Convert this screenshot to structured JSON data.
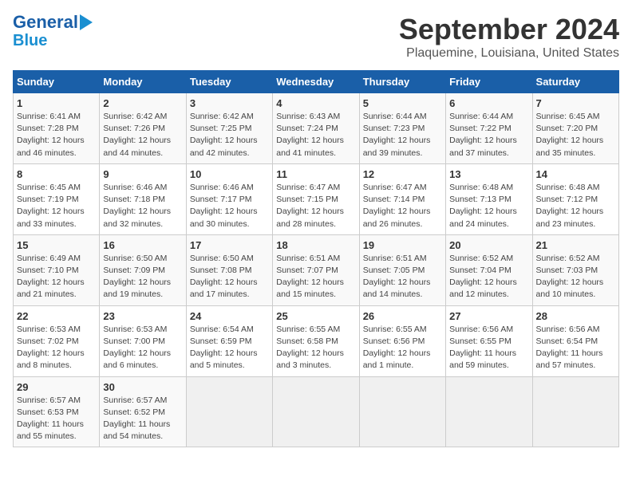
{
  "header": {
    "logo_line1": "General",
    "logo_line2": "Blue",
    "title": "September 2024",
    "subtitle": "Plaquemine, Louisiana, United States"
  },
  "calendar": {
    "days_of_week": [
      "Sunday",
      "Monday",
      "Tuesday",
      "Wednesday",
      "Thursday",
      "Friday",
      "Saturday"
    ],
    "weeks": [
      [
        null,
        {
          "day": 2,
          "sunrise": "6:42 AM",
          "sunset": "7:26 PM",
          "daylight": "12 hours and 44 minutes."
        },
        {
          "day": 3,
          "sunrise": "6:42 AM",
          "sunset": "7:25 PM",
          "daylight": "12 hours and 42 minutes."
        },
        {
          "day": 4,
          "sunrise": "6:43 AM",
          "sunset": "7:24 PM",
          "daylight": "12 hours and 41 minutes."
        },
        {
          "day": 5,
          "sunrise": "6:44 AM",
          "sunset": "7:23 PM",
          "daylight": "12 hours and 39 minutes."
        },
        {
          "day": 6,
          "sunrise": "6:44 AM",
          "sunset": "7:22 PM",
          "daylight": "12 hours and 37 minutes."
        },
        {
          "day": 7,
          "sunrise": "6:45 AM",
          "sunset": "7:20 PM",
          "daylight": "12 hours and 35 minutes."
        }
      ],
      [
        {
          "day": 1,
          "sunrise": "6:41 AM",
          "sunset": "7:28 PM",
          "daylight": "12 hours and 46 minutes."
        },
        null,
        null,
        null,
        null,
        null,
        null
      ],
      [
        {
          "day": 8,
          "sunrise": "6:45 AM",
          "sunset": "7:19 PM",
          "daylight": "12 hours and 33 minutes."
        },
        {
          "day": 9,
          "sunrise": "6:46 AM",
          "sunset": "7:18 PM",
          "daylight": "12 hours and 32 minutes."
        },
        {
          "day": 10,
          "sunrise": "6:46 AM",
          "sunset": "7:17 PM",
          "daylight": "12 hours and 30 minutes."
        },
        {
          "day": 11,
          "sunrise": "6:47 AM",
          "sunset": "7:15 PM",
          "daylight": "12 hours and 28 minutes."
        },
        {
          "day": 12,
          "sunrise": "6:47 AM",
          "sunset": "7:14 PM",
          "daylight": "12 hours and 26 minutes."
        },
        {
          "day": 13,
          "sunrise": "6:48 AM",
          "sunset": "7:13 PM",
          "daylight": "12 hours and 24 minutes."
        },
        {
          "day": 14,
          "sunrise": "6:48 AM",
          "sunset": "7:12 PM",
          "daylight": "12 hours and 23 minutes."
        }
      ],
      [
        {
          "day": 15,
          "sunrise": "6:49 AM",
          "sunset": "7:10 PM",
          "daylight": "12 hours and 21 minutes."
        },
        {
          "day": 16,
          "sunrise": "6:50 AM",
          "sunset": "7:09 PM",
          "daylight": "12 hours and 19 minutes."
        },
        {
          "day": 17,
          "sunrise": "6:50 AM",
          "sunset": "7:08 PM",
          "daylight": "12 hours and 17 minutes."
        },
        {
          "day": 18,
          "sunrise": "6:51 AM",
          "sunset": "7:07 PM",
          "daylight": "12 hours and 15 minutes."
        },
        {
          "day": 19,
          "sunrise": "6:51 AM",
          "sunset": "7:05 PM",
          "daylight": "12 hours and 14 minutes."
        },
        {
          "day": 20,
          "sunrise": "6:52 AM",
          "sunset": "7:04 PM",
          "daylight": "12 hours and 12 minutes."
        },
        {
          "day": 21,
          "sunrise": "6:52 AM",
          "sunset": "7:03 PM",
          "daylight": "12 hours and 10 minutes."
        }
      ],
      [
        {
          "day": 22,
          "sunrise": "6:53 AM",
          "sunset": "7:02 PM",
          "daylight": "12 hours and 8 minutes."
        },
        {
          "day": 23,
          "sunrise": "6:53 AM",
          "sunset": "7:00 PM",
          "daylight": "12 hours and 6 minutes."
        },
        {
          "day": 24,
          "sunrise": "6:54 AM",
          "sunset": "6:59 PM",
          "daylight": "12 hours and 5 minutes."
        },
        {
          "day": 25,
          "sunrise": "6:55 AM",
          "sunset": "6:58 PM",
          "daylight": "12 hours and 3 minutes."
        },
        {
          "day": 26,
          "sunrise": "6:55 AM",
          "sunset": "6:56 PM",
          "daylight": "12 hours and 1 minute."
        },
        {
          "day": 27,
          "sunrise": "6:56 AM",
          "sunset": "6:55 PM",
          "daylight": "11 hours and 59 minutes."
        },
        {
          "day": 28,
          "sunrise": "6:56 AM",
          "sunset": "6:54 PM",
          "daylight": "11 hours and 57 minutes."
        }
      ],
      [
        {
          "day": 29,
          "sunrise": "6:57 AM",
          "sunset": "6:53 PM",
          "daylight": "11 hours and 55 minutes."
        },
        {
          "day": 30,
          "sunrise": "6:57 AM",
          "sunset": "6:52 PM",
          "daylight": "11 hours and 54 minutes."
        },
        null,
        null,
        null,
        null,
        null
      ]
    ]
  }
}
